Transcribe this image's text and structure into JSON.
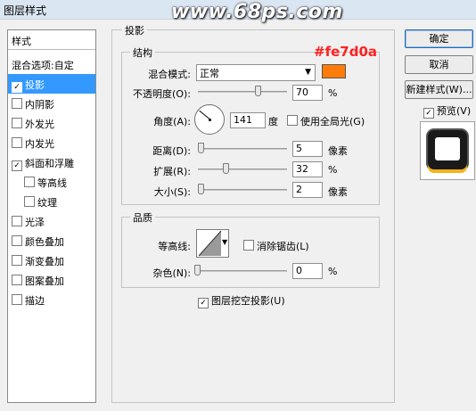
{
  "window": {
    "title": "图层样式",
    "watermark": "www.68ps.com"
  },
  "styles": {
    "header": "样式",
    "blending_options": "混合选项:自定",
    "items": [
      {
        "label": "投影",
        "checked": true,
        "selected": true
      },
      {
        "label": "内阴影",
        "checked": false
      },
      {
        "label": "外发光",
        "checked": false
      },
      {
        "label": "内发光",
        "checked": false
      },
      {
        "label": "斜面和浮雕",
        "checked": true
      },
      {
        "label": "等高线",
        "checked": false
      },
      {
        "label": "纹理",
        "checked": false
      },
      {
        "label": "光泽",
        "checked": false
      },
      {
        "label": "颜色叠加",
        "checked": false
      },
      {
        "label": "渐变叠加",
        "checked": false
      },
      {
        "label": "图案叠加",
        "checked": false
      },
      {
        "label": "描边",
        "checked": false
      }
    ]
  },
  "shadow": {
    "section_title": "投影",
    "structure_title": "结构",
    "color_annotation": "#fe7d0a",
    "blend_mode_label": "混合模式:",
    "blend_mode_value": "正常",
    "swatch_color": "#fe7d0a",
    "opacity_label": "不透明度(O):",
    "opacity_value": "70",
    "opacity_level": 0.7,
    "percent": "%",
    "angle_label": "角度(A):",
    "angle_value": "141",
    "degree_unit": "度",
    "global_light_label": "使用全局光(G)",
    "global_light_checked": false,
    "distance_label": "距离(D):",
    "distance_value": "5",
    "pixel_unit": "像素",
    "spread_label": "扩展(R):",
    "spread_value": "32",
    "spread_level": 0.32,
    "size_label": "大小(S):",
    "size_value": "2",
    "quality_title": "品质",
    "contour_label": "等高线:",
    "antialias_label": "消除锯齿(L)",
    "antialias_checked": false,
    "noise_label": "杂色(N):",
    "noise_value": "0",
    "noise_level": 0,
    "knockout_label": "图层挖空投影(U)",
    "knockout_checked": true
  },
  "buttons": {
    "ok": "确定",
    "cancel": "取消",
    "new_style": "新建样式(W)...",
    "preview": "预览(V)",
    "preview_checked": true
  }
}
